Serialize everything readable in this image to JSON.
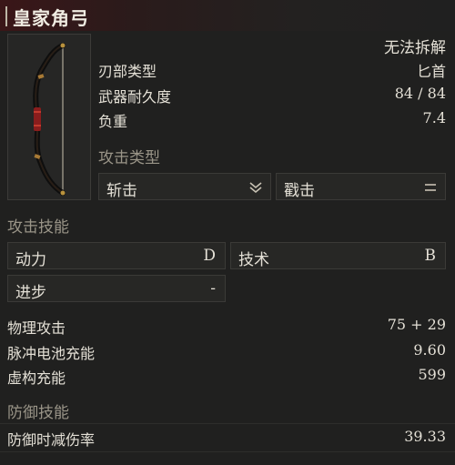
{
  "item": {
    "name": "皇家角弓",
    "status": "无法拆解"
  },
  "attributes": [
    {
      "label": "刃部类型",
      "value": "匕首"
    },
    {
      "label": "武器耐久度",
      "value": "84 / 84"
    },
    {
      "label": "负重",
      "value": "7.4"
    }
  ],
  "attack_type": {
    "heading": "攻击类型",
    "options": [
      {
        "label": "斩击",
        "icon": "double-chevron-down-icon"
      },
      {
        "label": "戳击",
        "icon": "equals-icon"
      }
    ]
  },
  "attack_skill": {
    "heading": "攻击技能",
    "stats": [
      {
        "label": "动力",
        "grade": "D"
      },
      {
        "label": "技术",
        "grade": "B"
      },
      {
        "label": "进步",
        "grade": "-"
      }
    ]
  },
  "attack_stats": [
    {
      "label": "物理攻击",
      "value": "75 + 29"
    },
    {
      "label": "脉冲电池充能",
      "value": "9.60"
    },
    {
      "label": "虚构充能",
      "value": "599"
    }
  ],
  "defense_skill": {
    "heading": "防御技能",
    "stats": [
      {
        "label": "防御时减伤率",
        "value": "39.33"
      }
    ]
  },
  "colors": {
    "title_gradient_start": "#3a1618",
    "panel_bg": "#20201f",
    "box_bg": "#272725",
    "section_label": "#9a9588"
  }
}
